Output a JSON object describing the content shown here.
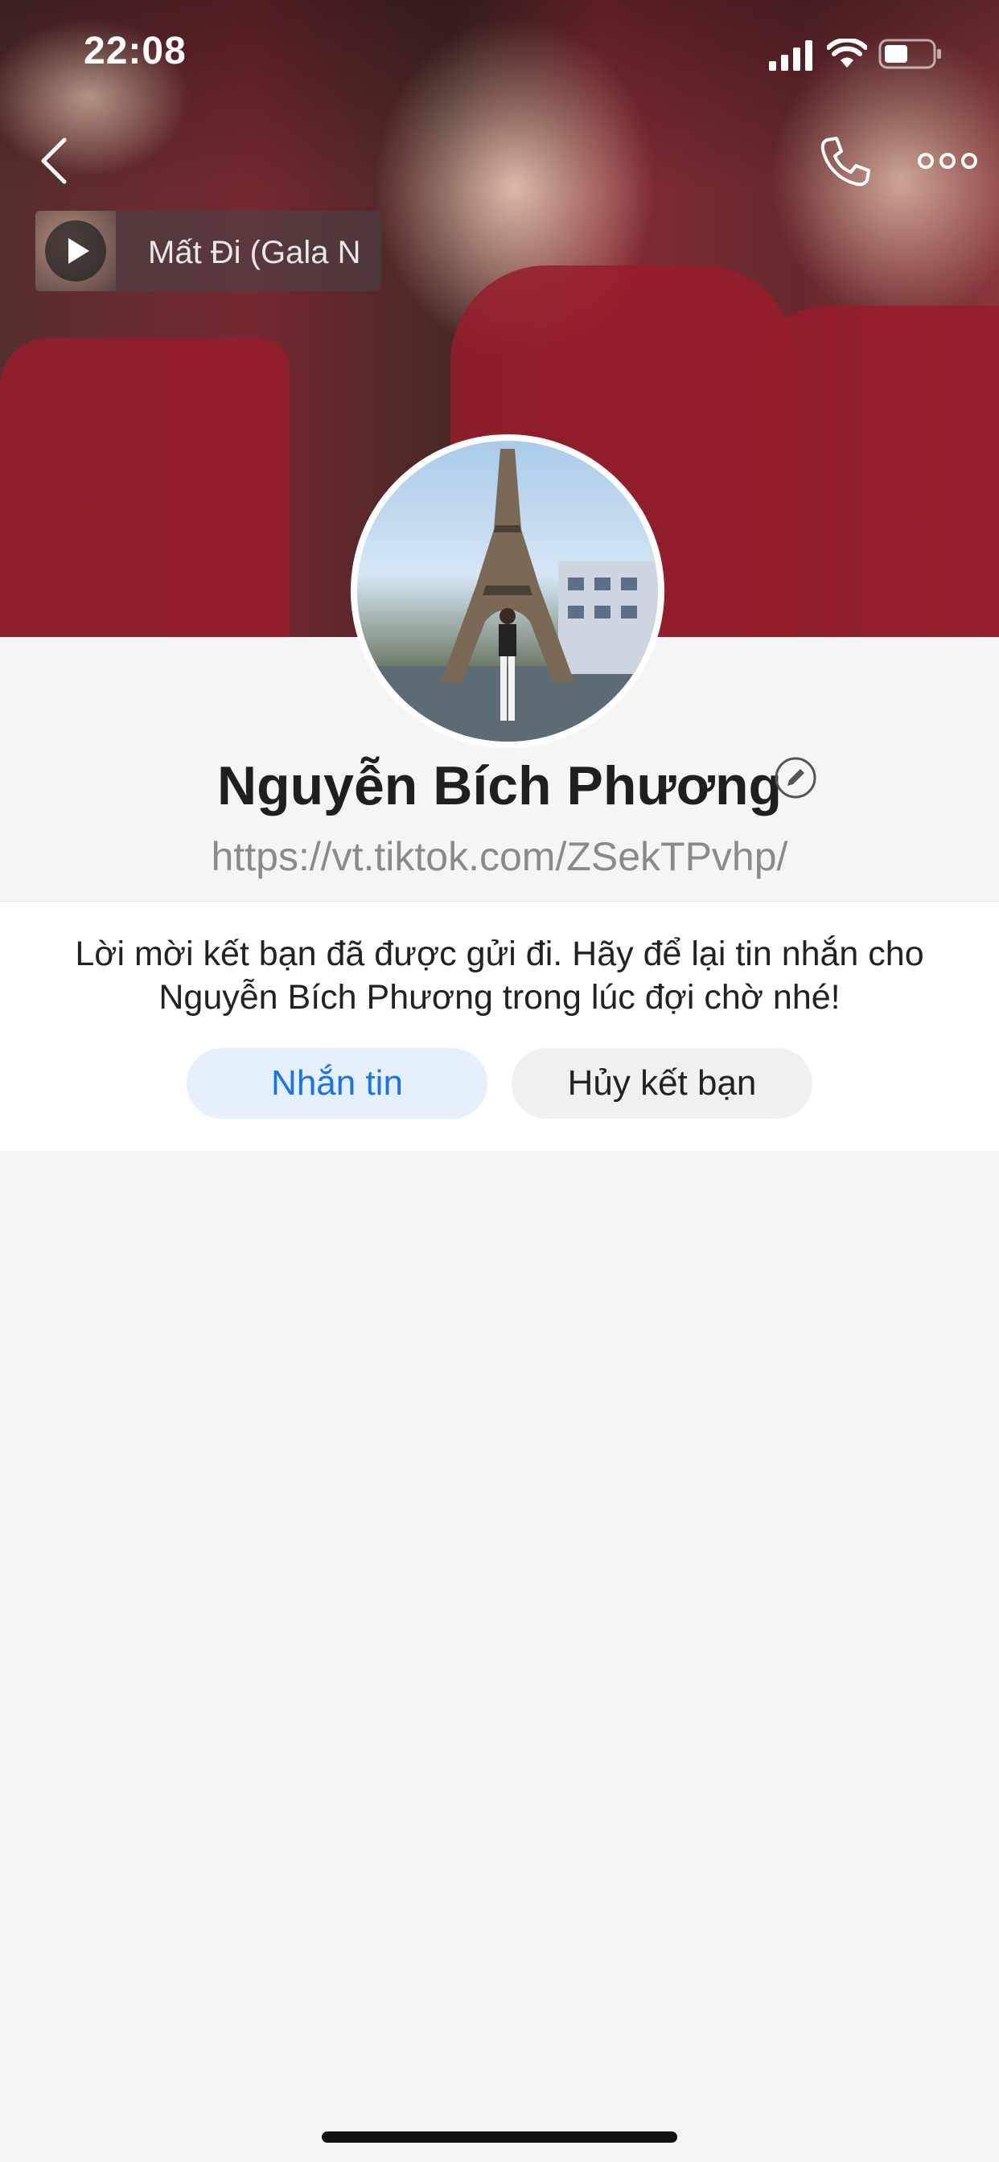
{
  "status_bar": {
    "time": "22:08",
    "icons": [
      "cellular-signal-icon",
      "wifi-icon",
      "battery-icon"
    ]
  },
  "top_bar": {
    "icons": [
      "back-chevron-icon",
      "phone-call-icon",
      "more-options-icon"
    ]
  },
  "music": {
    "title": "Mất Đi (Gala N",
    "icon": "play-icon"
  },
  "profile": {
    "name": "Nguyễn Bích Phương",
    "link": "https://vt.tiktok.com/ZSekTPvhp/",
    "edit_icon": "edit-pencil-icon"
  },
  "friend_request": {
    "message": "Lời mời kết bạn đã được gửi đi. Hãy để lại tin nhắn cho Nguyễn Bích Phương trong lúc đợi chờ nhé!",
    "message_button": "Nhắn tin",
    "cancel_button": "Hủy kết bạn"
  },
  "colors": {
    "accent": "#1a73e8",
    "background": "#f4f5f5",
    "card": "#ffffff"
  }
}
